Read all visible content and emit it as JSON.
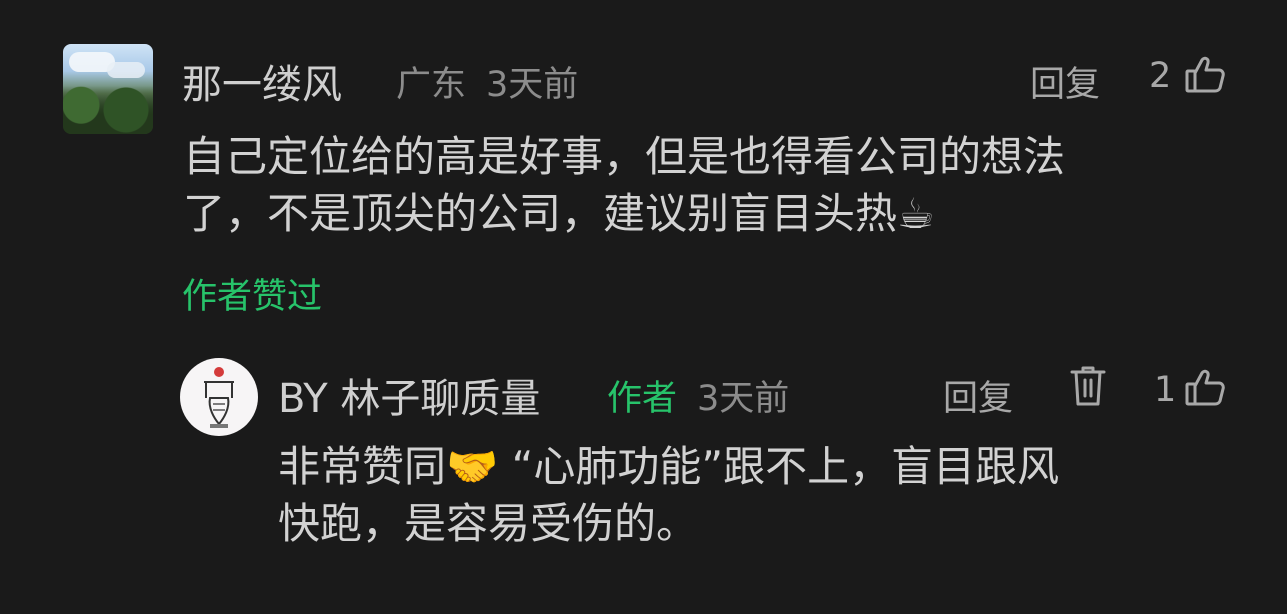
{
  "comment": {
    "author": "那一缕风",
    "location": "广东",
    "time": "3天前",
    "reply_label": "回复",
    "like_count": "2",
    "text_line1": "自己定位给的高是好事，但是也得看公司的想法",
    "text_line2": "了，不是顶尖的公司，建议别盲目头热☕",
    "author_liked_label": "作者赞过"
  },
  "reply": {
    "author": "BY 林子聊质量",
    "author_tag": "作者",
    "time": "3天前",
    "reply_label": "回复",
    "like_count": "1",
    "text_line1": "非常赞同🤝 “心肺功能”跟不上，盲目跟风",
    "text_line2": "快跑，是容易受伤的。"
  },
  "colors": {
    "background": "#1a1a1a",
    "text": "#d2d2d2",
    "meta": "#8c8c8c",
    "accent_green": "#27c36a"
  },
  "icons": {
    "like": "thumbs-up-icon",
    "delete": "trash-icon"
  }
}
